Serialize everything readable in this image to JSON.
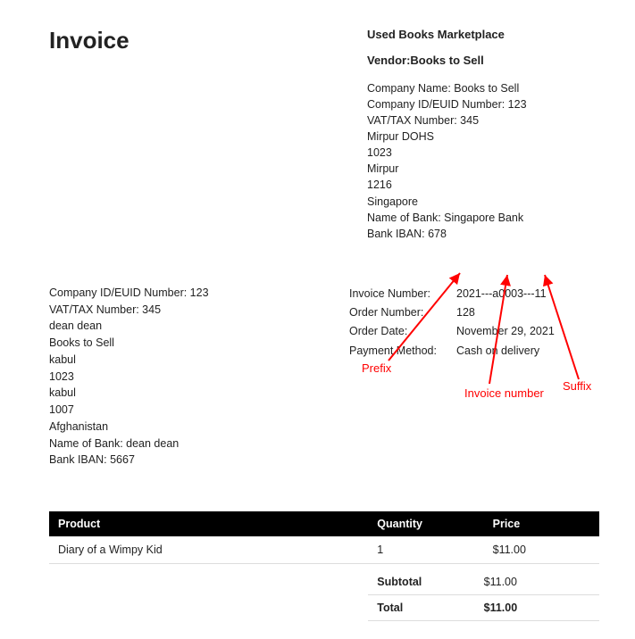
{
  "header": {
    "title": "Invoice",
    "marketplace": "Used Books Marketplace",
    "vendor_label": "Vendor:Books to Sell"
  },
  "vendor": {
    "company_name": "Company Name: Books to Sell",
    "company_id": "Company ID/EUID Number: 123",
    "vat": "VAT/TAX Number: 345",
    "addr1": "Mirpur DOHS",
    "addr2": "1023",
    "city": "Mirpur",
    "zip": "1216",
    "country": "Singapore",
    "bank_name": "Name of Bank: Singapore Bank",
    "bank_iban": "Bank IBAN: 678"
  },
  "buyer": {
    "company_id": "Company ID/EUID Number: 123",
    "vat": "VAT/TAX Number: 345",
    "name": "dean dean",
    "company": "Books to Sell",
    "addr1": "kabul",
    "addr2": "1023",
    "city": "kabul",
    "zip": "1007",
    "country": "Afghanistan",
    "bank_name": "Name of Bank: dean dean",
    "bank_iban": "Bank IBAN: 5667"
  },
  "order": {
    "invoice_number_label": "Invoice Number:",
    "invoice_number": "2021---a0003---11",
    "order_number_label": "Order Number:",
    "order_number": "128",
    "order_date_label": "Order Date:",
    "order_date": "November 29, 2021",
    "payment_method_label": "Payment Method:",
    "payment_method": "Cash on delivery"
  },
  "table": {
    "headers": {
      "product": "Product",
      "quantity": "Quantity",
      "price": "Price"
    },
    "rows": [
      {
        "product": "Diary of a Wimpy Kid",
        "quantity": "1",
        "price": "$11.00"
      }
    ]
  },
  "totals": {
    "subtotal_label": "Subtotal",
    "subtotal": "$11.00",
    "total_label": "Total",
    "total": "$11.00"
  },
  "annotations": {
    "prefix": "Prefix",
    "invoice_number": "Invoice number",
    "suffix": "Suffix"
  }
}
